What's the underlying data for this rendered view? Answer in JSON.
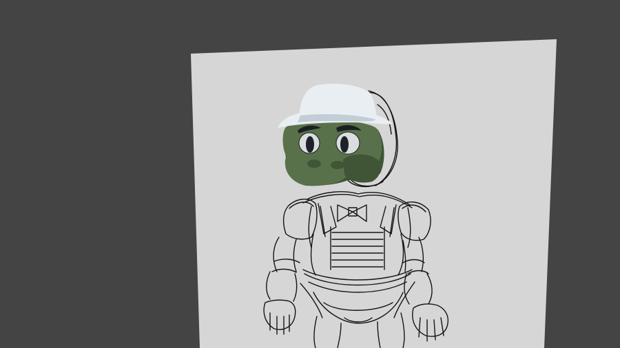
{
  "viewport": {
    "background_color": "#444444"
  },
  "reference_plane": {
    "color": "#d6d6d6",
    "shade_color": "#c9c9c9"
  },
  "model_head": {
    "skin_color": "#58714a",
    "skin_shadow_color": "#3f5535",
    "hat_color": "#e9eef2",
    "hat_shadow_color": "#c3cdd6",
    "eye_color": "#d9dde0",
    "pupil_color": "#1e2228",
    "brow_color": "#1c1f22"
  },
  "sketch": {
    "line_color": "#141414"
  }
}
